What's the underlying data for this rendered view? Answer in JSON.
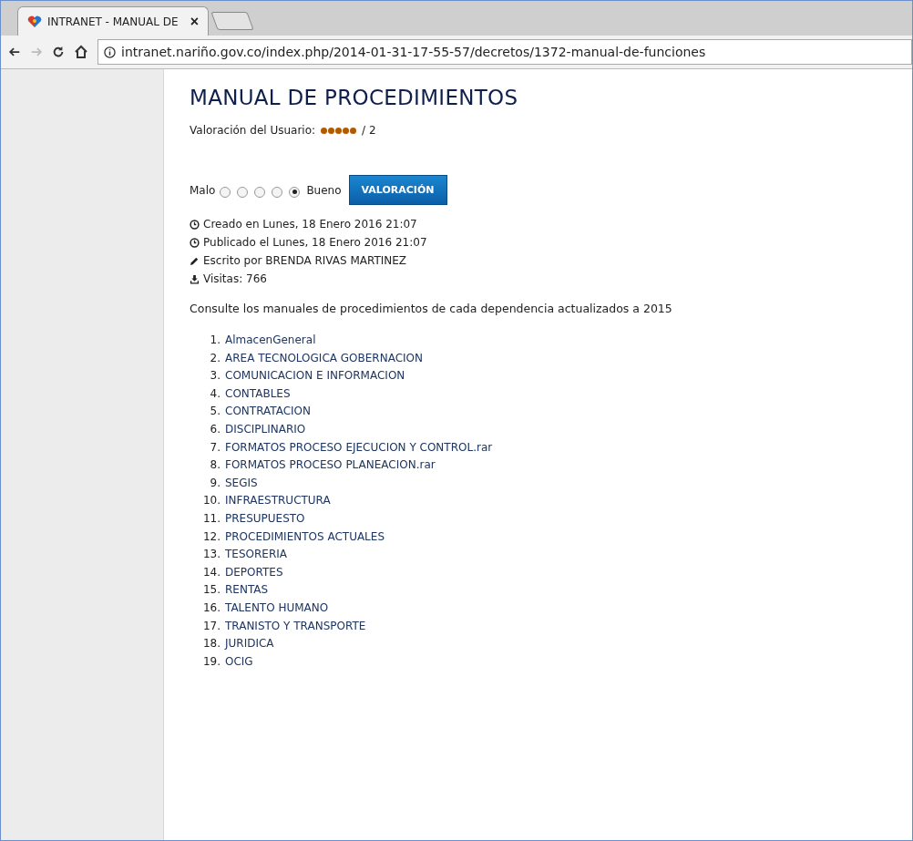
{
  "browser": {
    "tab": {
      "title": "INTRANET - MANUAL DE",
      "close": "×"
    },
    "forward_disabled": true,
    "url": "intranet.nariño.gov.co/index.php/2014-01-31-17-55-57/decretos/1372-manual-de-funciones"
  },
  "article": {
    "title": "MANUAL DE PROCEDIMIENTOS",
    "user_rating": {
      "label": "Valoración del Usuario:",
      "stars": 5,
      "suffix": "/ 2"
    },
    "vote": {
      "low": "Malo",
      "high": "Bueno",
      "options": [
        {
          "selected": false
        },
        {
          "selected": false
        },
        {
          "selected": false
        },
        {
          "selected": false
        },
        {
          "selected": true
        }
      ],
      "button": "VALORACIÓN"
    },
    "info": [
      {
        "kind": "clock",
        "text": "Creado en Lunes, 18 Enero 2016 21:07"
      },
      {
        "kind": "clock",
        "text": "Publicado el Lunes, 18 Enero 2016 21:07"
      },
      {
        "kind": "pencil",
        "text": "Escrito por BRENDA RIVAS MARTINEZ"
      },
      {
        "kind": "download",
        "text": "Visitas: 766"
      }
    ],
    "intro": "Consulte los manuales de procedimientos de cada dependencia actualizados a 2015",
    "links": [
      {
        "number": "1.",
        "label": "AlmacenGeneral"
      },
      {
        "number": "2.",
        "label": "AREA TECNOLOGICA GOBERNACION"
      },
      {
        "number": "3.",
        "label": "COMUNICACION E INFORMACION"
      },
      {
        "number": "4.",
        "label": "CONTABLES"
      },
      {
        "number": "5.",
        "label": "CONTRATACION"
      },
      {
        "number": "6.",
        "label": "DISCIPLINARIO"
      },
      {
        "number": "7.",
        "label": "FORMATOS PROCESO EJECUCION Y CONTROL.rar"
      },
      {
        "number": "8.",
        "label": "FORMATOS PROCESO PLANEACION.rar"
      },
      {
        "number": "9.",
        "label": "SEGIS"
      },
      {
        "number": "10.",
        "label": "INFRAESTRUCTURA"
      },
      {
        "number": "11.",
        "label": "PRESUPUESTO"
      },
      {
        "number": "12.",
        "label": "PROCEDIMIENTOS ACTUALES"
      },
      {
        "number": "13.",
        "label": "TESORERIA"
      },
      {
        "number": "14.",
        "label": "DEPORTES"
      },
      {
        "number": "15.",
        "label": "RENTAS"
      },
      {
        "number": "16.",
        "label": "TALENTO HUMANO"
      },
      {
        "number": "17.",
        "label": "TRANISTO Y TRANSPORTE"
      },
      {
        "number": "18.",
        "label": "JURIDICA"
      },
      {
        "number": "19.",
        "label": "OCIG"
      }
    ]
  }
}
